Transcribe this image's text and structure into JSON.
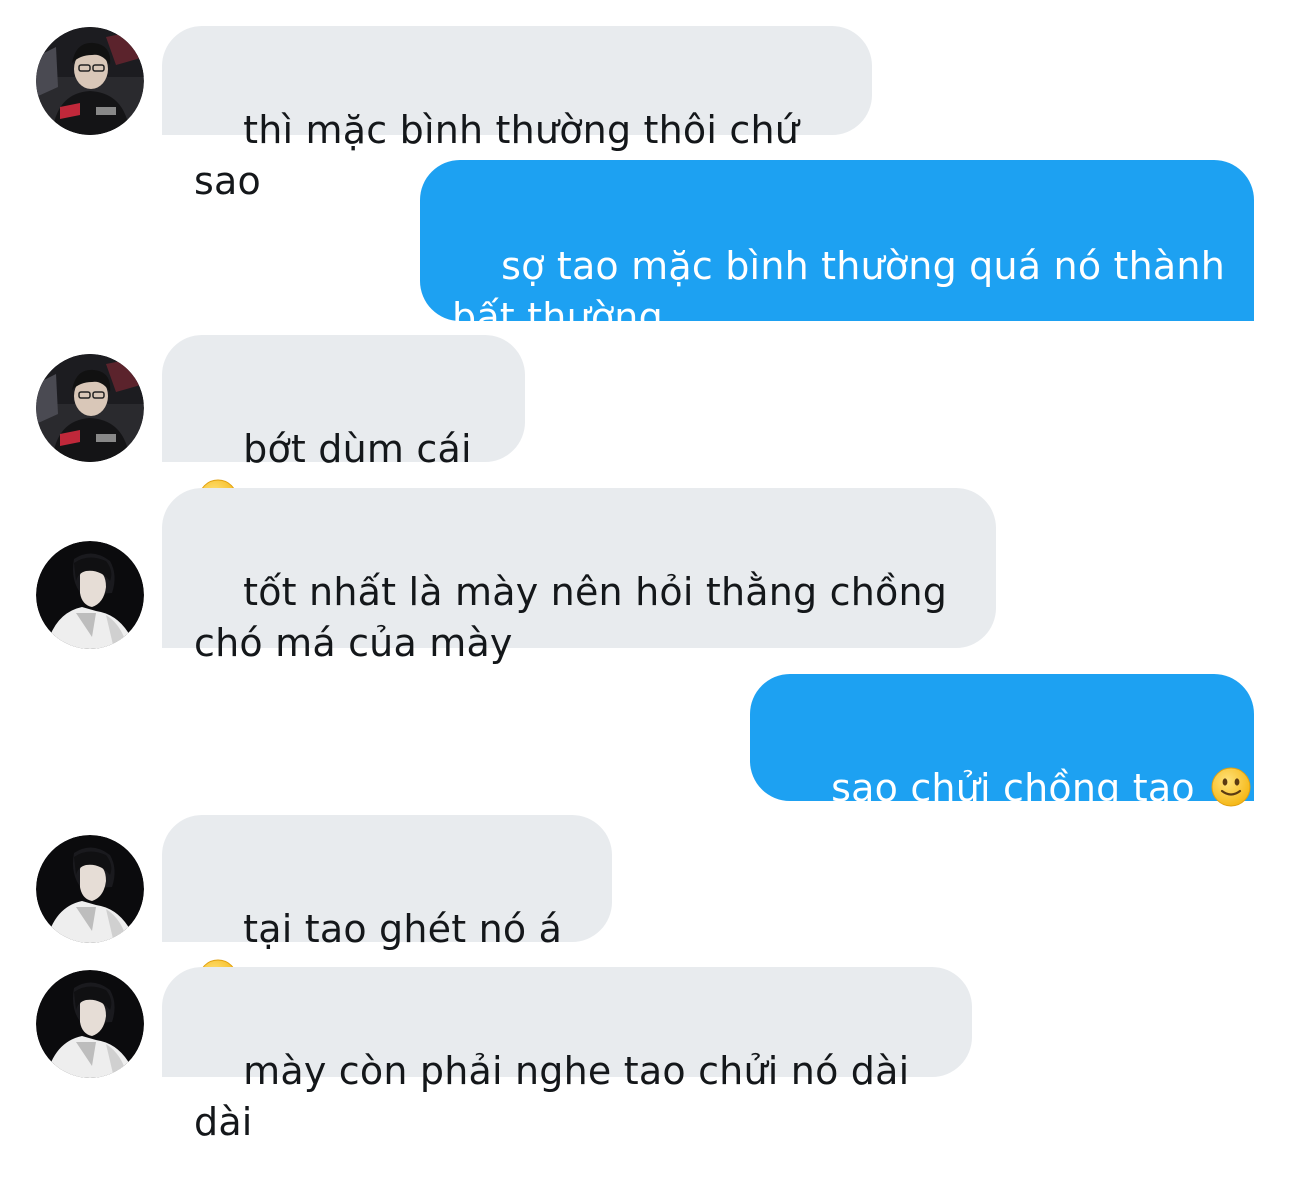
{
  "messages": [
    {
      "id": "m1",
      "direction": "incoming",
      "sender": "friend-a",
      "text": "thì mặc bình thường thôi chứ sao",
      "emoji": null
    },
    {
      "id": "m2",
      "direction": "outgoing",
      "sender": "me",
      "text": "sợ tao mặc bình thường quá nó thành\nbất thường",
      "emoji": null
    },
    {
      "id": "m3",
      "direction": "incoming",
      "sender": "friend-a",
      "text": "bớt dùm cái ",
      "emoji": "slightly-smiling-face"
    },
    {
      "id": "m4",
      "direction": "incoming",
      "sender": "friend-b",
      "text": "tốt nhất là mày nên hỏi thằng chồng\nchó má của mày",
      "emoji": null
    },
    {
      "id": "m5",
      "direction": "outgoing",
      "sender": "me",
      "text": "sao chửi chồng tao ",
      "emoji": "slightly-smiling-face"
    },
    {
      "id": "m6",
      "direction": "incoming",
      "sender": "friend-b",
      "text": "tại tao ghét nó á ",
      "emoji": "slightly-smiling-face"
    },
    {
      "id": "m7",
      "direction": "incoming",
      "sender": "friend-b",
      "text": "mày còn phải nghe tao chửi nó dài dài",
      "emoji": null
    }
  ],
  "colors": {
    "incoming_bubble": "#e8ebee",
    "incoming_text": "#14171a",
    "outgoing_bubble": "#1da1f2",
    "outgoing_text": "#ffffff"
  }
}
